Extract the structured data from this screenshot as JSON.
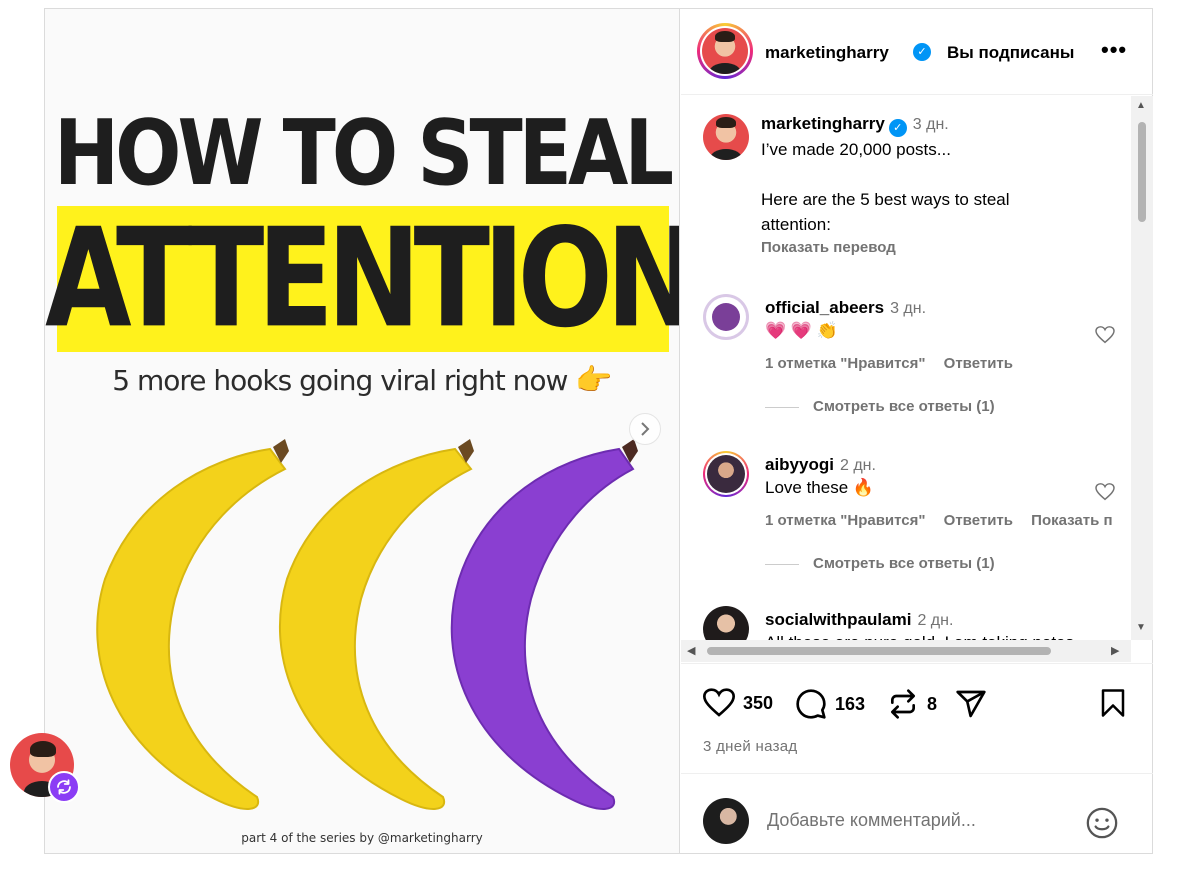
{
  "post": {
    "headline_line1": "HOW TO STEAL",
    "headline_line2": "ATTENTION",
    "subline": "5 more hooks going viral right now",
    "caption": "part 4 of the series by @marketingharry"
  },
  "header": {
    "username": "marketingharry",
    "follow_status": "Вы подписаны",
    "more_label": "•••"
  },
  "caption_comment": {
    "username": "marketingharry",
    "time": "3 дн.",
    "line1": "I’ve made 20,000 posts...",
    "line2": "Here are the 5 best ways to steal",
    "line3": "attention:",
    "translate": "Показать перевод"
  },
  "comments": [
    {
      "username": "official_abeers",
      "time": "3 дн.",
      "text": "💗 💗 👏",
      "likes": "1 отметка \"Нравится\"",
      "reply": "Ответить",
      "view_replies": "Смотреть все ответы (1)"
    },
    {
      "username": "aibyyogi",
      "time": "2 дн.",
      "text": "Love these 🔥",
      "likes": "1 отметка \"Нравится\"",
      "reply": "Ответить",
      "translate": "Показать п",
      "view_replies": "Смотреть все ответы (1)"
    },
    {
      "username": "socialwithpaulami",
      "time": "2 дн.",
      "text": "All these are pure gold. I am taking notes"
    }
  ],
  "actions": {
    "likes": "350",
    "comments": "163",
    "reposts": "8",
    "posted": "3 дней назад"
  },
  "composer": {
    "placeholder": "Добавьте комментарий..."
  },
  "colors": {
    "highlight": "#fff21c",
    "verified": "#0095f6",
    "muted": "#737373",
    "banana_yellow": "#f3d21b",
    "banana_purple": "#8a3fd1"
  }
}
